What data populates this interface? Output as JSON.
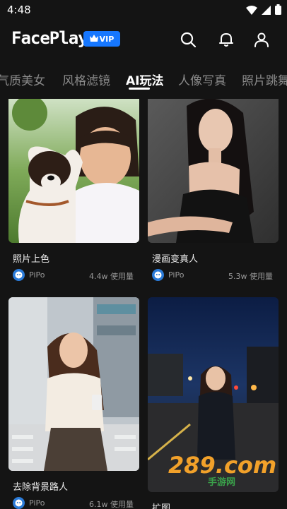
{
  "status": {
    "time": "4:48"
  },
  "header": {
    "logo": "FacePlay",
    "vip_label": "VIP"
  },
  "tabs": [
    {
      "label": "气质美女"
    },
    {
      "label": "风格滤镜"
    },
    {
      "label": "AI玩法"
    },
    {
      "label": "人像写真"
    },
    {
      "label": "照片跳舞"
    }
  ],
  "cards": [
    {
      "title": "照片上色",
      "author": "PiPo",
      "usage": "4.4w 使用量"
    },
    {
      "title": "漫画变真人",
      "author": "PiPo",
      "usage": "5.3w 使用量"
    },
    {
      "title": "去除背景路人",
      "author": "PiPo",
      "usage": "6.1w 使用量"
    },
    {
      "title": "扩图",
      "author": "",
      "usage": ""
    }
  ],
  "watermark": {
    "text": "289.com",
    "subtext": "手游网"
  }
}
